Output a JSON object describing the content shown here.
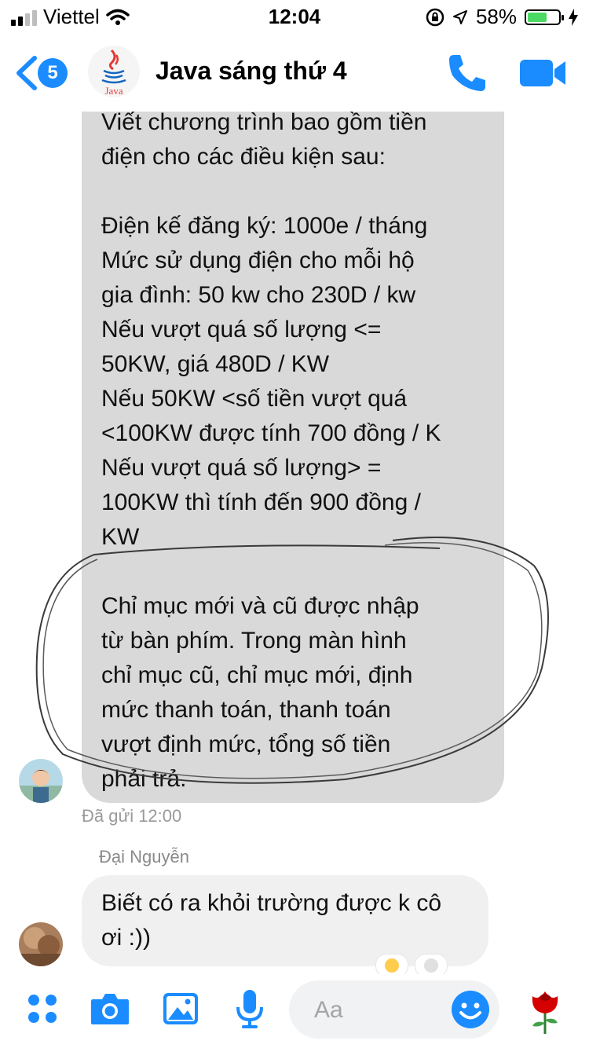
{
  "status_bar": {
    "carrier": "Viettel",
    "time": "12:04",
    "battery": "58%",
    "battery_level": 0.58
  },
  "header": {
    "unread_count": "5",
    "chat_title": "Java sáng thứ 4",
    "avatar_label": "Java"
  },
  "messages": {
    "main_text": "Viết chương trình bao gồm tiền\nđiện cho các điều kiện sau:\n\nĐiện kế đăng ký: 1000e / tháng\nMức sử dụng điện cho mỗi hộ\ngia đình: 50 kw cho 230D / kw\nNếu vượt quá số lượng <=\n50KW, giá 480D / KW\nNếu 50KW <số tiền vượt quá\n<100KW được tính 700 đồng / K\nNếu vượt quá số lượng> =\n100KW thì tính đến 900 đồng /\nKW\n\nChỉ mục mới và cũ được nhập\ntừ bàn phím. Trong màn hình\nchỉ mục cũ, chỉ mục mới, định\nmức thanh toán, thanh toán\nvượt định mức, tổng số tiền\nphải trả.",
    "sent_status": "Đã gửi 12:00",
    "reply_sender": "Đại Nguyễn",
    "reply_text": "Biết có ra khỏi trường được k cô\nơi :))"
  },
  "composer": {
    "placeholder": "Aa"
  },
  "colors": {
    "accent": "#1a8cff",
    "bubble_gray": "#d9d9d9",
    "battery_green": "#4cd964"
  },
  "icons": [
    "signal-icon",
    "wifi-icon",
    "rotation-lock-icon",
    "location-icon",
    "battery-icon",
    "charging-icon",
    "back-chevron-icon",
    "phone-icon",
    "video-icon",
    "apps-grid-icon",
    "camera-icon",
    "image-icon",
    "microphone-icon",
    "emoji-icon",
    "rose-icon"
  ]
}
